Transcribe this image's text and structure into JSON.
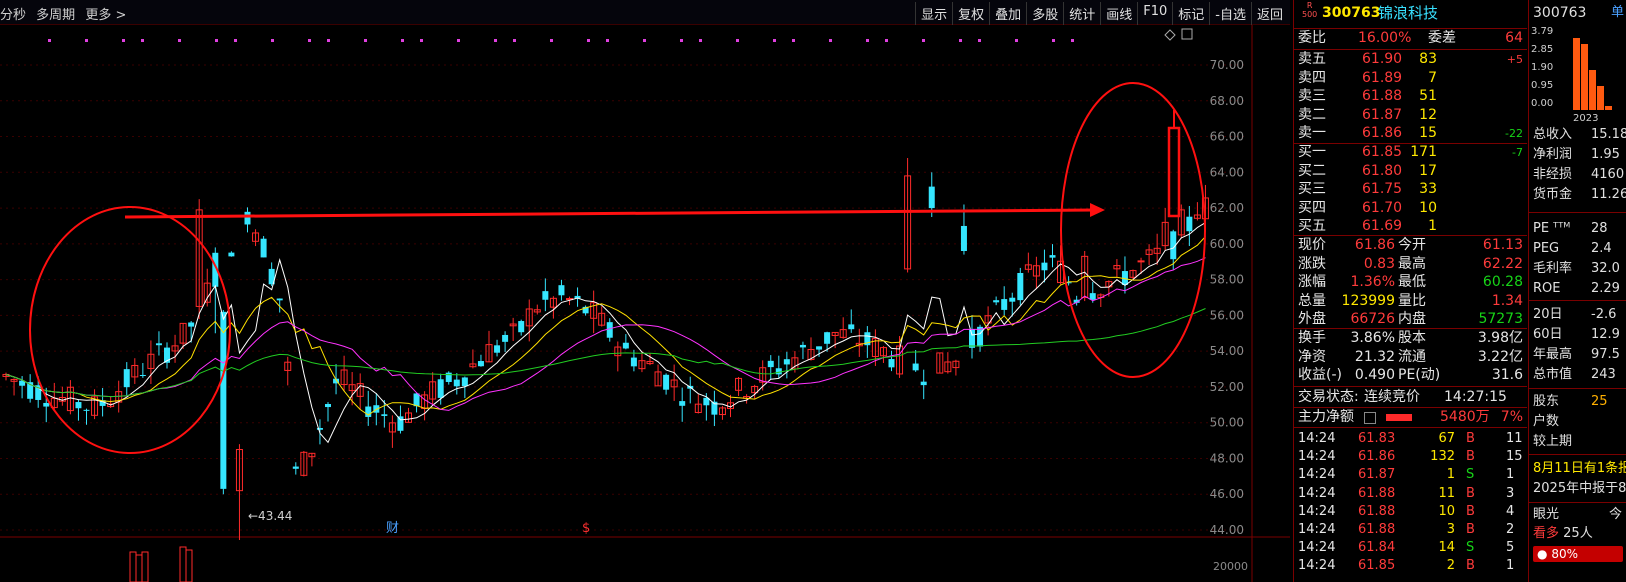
{
  "toolbar": {
    "left": [
      "分秒",
      "多周期",
      "更多 >"
    ],
    "right": [
      "显示",
      "复权",
      "叠加",
      "多股",
      "统计",
      "画线",
      "F10",
      "标记",
      "-自选",
      "返回"
    ]
  },
  "chart": {
    "y_ticks": [
      "70.00",
      "68.00",
      "66.00",
      "64.00",
      "62.00",
      "60.00",
      "58.00",
      "56.00",
      "54.00",
      "52.00",
      "50.00",
      "48.00",
      "46.00",
      "44.00"
    ],
    "low_label": "43.44",
    "marker_cai": "财",
    "marker_s": "$",
    "vol_tick": "20000",
    "colors": {
      "up": "#ff2a2a",
      "down": "#35e6ff",
      "ma5": "#ffffff",
      "ma10": "#ffe100",
      "ma20": "#ff33ff",
      "ma60": "#22cc22",
      "annot": "#ff1010"
    }
  },
  "quote": {
    "badge_top": "R",
    "badge_bot": "500",
    "code": "300763",
    "name": "锦浪科技",
    "weibi_label": "委比",
    "weibi": "16.00%",
    "weicha_label": "委差",
    "weicha": "64",
    "asks": [
      {
        "label": "卖五",
        "price": "61.90",
        "vol": "83",
        "chg": "+5"
      },
      {
        "label": "卖四",
        "price": "61.89",
        "vol": "7",
        "chg": ""
      },
      {
        "label": "卖三",
        "price": "61.88",
        "vol": "51",
        "chg": ""
      },
      {
        "label": "卖二",
        "price": "61.87",
        "vol": "12",
        "chg": ""
      },
      {
        "label": "卖一",
        "price": "61.86",
        "vol": "15",
        "chg": "-22"
      }
    ],
    "bids": [
      {
        "label": "买一",
        "price": "61.85",
        "vol": "171",
        "chg": "-7"
      },
      {
        "label": "买二",
        "price": "61.80",
        "vol": "17",
        "chg": ""
      },
      {
        "label": "买三",
        "price": "61.75",
        "vol": "33",
        "chg": ""
      },
      {
        "label": "买四",
        "price": "61.70",
        "vol": "10",
        "chg": ""
      },
      {
        "label": "买五",
        "price": "61.69",
        "vol": "1",
        "chg": ""
      }
    ],
    "stats": [
      {
        "l1": "现价",
        "v1": "61.86",
        "c1": "red",
        "l2": "今开",
        "v2": "61.13",
        "c2": "red"
      },
      {
        "l1": "涨跌",
        "v1": "0.83",
        "c1": "red",
        "l2": "最高",
        "v2": "62.22",
        "c2": "red"
      },
      {
        "l1": "涨幅",
        "v1": "1.36%",
        "c1": "red",
        "l2": "最低",
        "v2": "60.28",
        "c2": "grn"
      },
      {
        "l1": "总量",
        "v1": "123999",
        "c1": "yel",
        "l2": "量比",
        "v2": "1.34",
        "c2": "red"
      },
      {
        "l1": "外盘",
        "v1": "66726",
        "c1": "red",
        "l2": "内盘",
        "v2": "57273",
        "c2": "grn"
      }
    ],
    "stats2": [
      {
        "l1": "换手",
        "v1": "3.86%",
        "l2": "股本",
        "v2": "3.98亿"
      },
      {
        "l1": "净资",
        "v1": "21.32",
        "l2": "流通",
        "v2": "3.22亿"
      },
      {
        "l1": "收益(-)",
        "v1": "0.490",
        "l2": "PE(动)",
        "v2": "31.6"
      }
    ],
    "status_label": "交易状态:",
    "status": "连续竞价",
    "status_time": "14:27:15",
    "main_flow_label": "主力净额",
    "main_flow": "5480万",
    "main_flow_pct": "7%",
    "ticks": [
      {
        "t": "14:24",
        "p": "61.83",
        "v": "67",
        "s": "B",
        "n": "11"
      },
      {
        "t": "14:24",
        "p": "61.86",
        "v": "132",
        "s": "B",
        "n": "15"
      },
      {
        "t": "14:24",
        "p": "61.87",
        "v": "1",
        "s": "S",
        "n": "1"
      },
      {
        "t": "14:24",
        "p": "61.88",
        "v": "11",
        "s": "B",
        "n": "3"
      },
      {
        "t": "14:24",
        "p": "61.88",
        "v": "10",
        "s": "B",
        "n": "4"
      },
      {
        "t": "14:24",
        "p": "61.88",
        "v": "3",
        "s": "B",
        "n": "2"
      },
      {
        "t": "14:24",
        "p": "61.84",
        "v": "14",
        "s": "S",
        "n": "5"
      },
      {
        "t": "14:24",
        "p": "61.85",
        "v": "2",
        "s": "B",
        "n": "1"
      }
    ]
  },
  "finance": {
    "code": "300763",
    "tab": "单",
    "bar_ticks": [
      "3.79",
      "2.85",
      "1.90",
      "0.95",
      "0.00"
    ],
    "bar_year": "2023",
    "rows": [
      {
        "l": "总收入",
        "v": "15.18"
      },
      {
        "l": "净利润",
        "v": "1.95"
      },
      {
        "l": "非经损",
        "v": "4160"
      },
      {
        "l": "货币金",
        "v": "11.26"
      }
    ],
    "rows2": [
      {
        "l": "PE ᵀᵀᴹ",
        "v": "28"
      },
      {
        "l": "PEG",
        "v": "2.4"
      },
      {
        "l": "毛利率",
        "v": "32.0"
      },
      {
        "l": "ROE",
        "v": "2.29"
      }
    ],
    "rows3": [
      {
        "l": "20日",
        "v": "-2.6"
      },
      {
        "l": "60日",
        "v": "12.9"
      },
      {
        "l": "年最高",
        "v": "97.5"
      },
      {
        "l": "总市值",
        "v": "243"
      }
    ],
    "rows4": [
      {
        "l": "股东",
        "v": "25"
      },
      {
        "l": "户数",
        "v": ""
      },
      {
        "l": "较上期",
        "v": ""
      }
    ],
    "news1": "8月11日有1条报",
    "news2": "2025年中报于8",
    "eye_label": "眼光",
    "eye_right": "今",
    "bull_label": "看多",
    "bull_count": "25人",
    "bull_pct": "80%"
  }
}
